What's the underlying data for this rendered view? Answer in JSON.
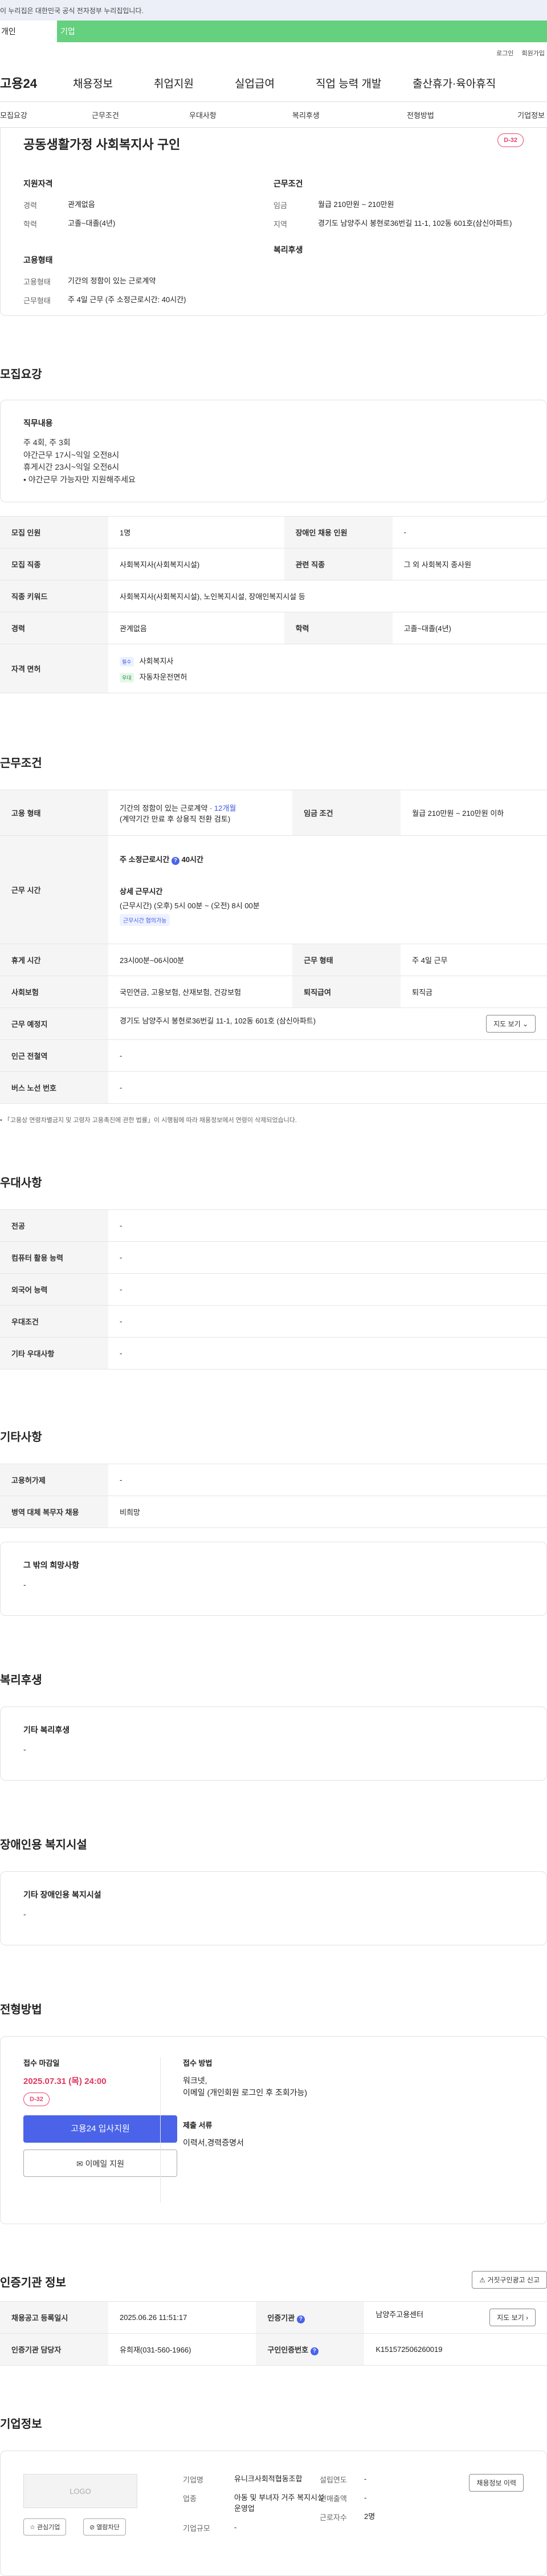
{
  "banner": "이 누리집은 대한민국 공식 전자정부 누리집입니다.",
  "tabs": [
    "개인",
    "기업"
  ],
  "util": [
    "로그인",
    "회원가입"
  ],
  "gnb": {
    "logo": "고용24",
    "items": [
      "채용정보",
      "취업지원",
      "실업급여",
      "직업 능력 개발",
      "출산휴가·육아휴직"
    ]
  },
  "subnav": [
    "모집요강",
    "근무조건",
    "우대사항",
    "복리후생",
    "전형방법",
    "기업정보"
  ],
  "summary": {
    "title": "공동생활가정 사회복지사 구인",
    "dday": "D-32",
    "qual_h": "지원자격",
    "career_k": "경력",
    "career_v": "관계없음",
    "edu_k": "학력",
    "edu_v": "고졸~대졸(4년)",
    "cond_h": "근무조건",
    "wage_k": "임금",
    "wage_v": "월급 210만원 ~ 210만원",
    "loc_k": "지역",
    "loc_v": "경기도 남양주시 봉현로36번길 11-1, 102동 601호(삼신아파트)",
    "emp_h": "고용형태",
    "emptype_k": "고용형태",
    "emptype_v": "기간의 정함이 있는 근로계약",
    "worktype_k": "근무형태",
    "worktype_v": "주 4일 근무 (주 소정근로시간: 40시간)",
    "welfare_h": "복리후생"
  },
  "recruit": {
    "title": "모집요강",
    "duty_h": "직무내용",
    "duty_lines": [
      "주 4회, 주 3회",
      "야간근무 17시~익일 오전8시",
      "휴게시간 23시~익일 오전6시",
      "• 야간근무 가능자만 지원해주세요"
    ],
    "rows": {
      "count_k": "모집 인원",
      "count_v": "1명",
      "disab_k": "장애인 채용 인원",
      "disab_v": "-",
      "job_k": "모집 직종",
      "job_v": "사회복지사(사회복지시설)",
      "rel_k": "관련 직종",
      "rel_v": "그 외 사회복지 종사원",
      "kw_k": "직종 키워드",
      "kw_v": "사회복지사(사회복지시설), 노인복지시설, 장애인복지시설 등",
      "career_k": "경력",
      "career_v": "관계없음",
      "edu_k": "학력",
      "edu_v": "고졸~대졸(4년)",
      "lic_k": "자격 면허",
      "tag1": "필수",
      "lic1": "사회복지사",
      "tag2": "우대",
      "lic2": "자동차운전면허"
    }
  },
  "work": {
    "title": "근무조건",
    "emp_k": "고용 형태",
    "emp_v": "기간의 정함이 있는 근로계약 · ",
    "emp_months": "12개월",
    "emp_sub": "(계약기간 만료 후 상용직 전환 검토)",
    "wage_k": "임금 조건",
    "wage_v": "월급 210만원 ~ 210만원 이하",
    "time_k": "근무 시간",
    "time_std": "주 소정근로시간",
    "time_std_v": "40시간",
    "time_detail_h": "상세 근무시간",
    "time_detail": "(근무시간) (오후) 5시 00분 ~ (오전) 8시 00분",
    "time_pill": "근무시간 협의가능",
    "rest_k": "휴게 시간",
    "rest_v": "23시00분~06시00분",
    "shape_k": "근무 형태",
    "shape_v": "주 4일 근무",
    "ins_k": "사회보험",
    "ins_v": "국민연금, 고용보험, 산재보험, 건강보험",
    "ret_k": "퇴직급여",
    "ret_v": "퇴직금",
    "place_k": "근무 예정지",
    "place_v": "경기도 남양주시 봉현로36번길 11-1, 102동 601호 (삼신아파트)",
    "map_btn": "지도 보기",
    "station_k": "인근 전철역",
    "station_v": "-",
    "bus_k": "버스 노선 번호",
    "bus_v": "-",
    "note": "「고용상 연령차별금지 및 고령자 고용촉진에 관한 법률」이 시행됨에 따라 채용정보에서 연령이 삭제되었습니다."
  },
  "pref": {
    "title": "우대사항",
    "rows": [
      [
        "전공",
        "-"
      ],
      [
        "컴퓨터 활용 능력",
        "-"
      ],
      [
        "외국어 능력",
        "-"
      ],
      [
        "우대조건",
        "-"
      ],
      [
        "기타 우대사항",
        "-"
      ]
    ]
  },
  "etc": {
    "title": "기타사항",
    "rows": [
      [
        "고용허가제",
        "-"
      ],
      [
        "병역 대체 복무자 채용",
        "비희망"
      ]
    ],
    "box_h": "그 밖의 희망사항",
    "box_v": "-"
  },
  "welfare": {
    "title": "복리후생",
    "box_h": "기타 복리후생",
    "box_v": "-"
  },
  "disab": {
    "title": "장애인용 복지시설",
    "box_h": "기타 장애인용 복지시설",
    "box_v": "-"
  },
  "apply": {
    "title": "전형방법",
    "deadline_h": "접수 마감일",
    "deadline": "2025.07.31 (목) 24:00",
    "dday": "D-32",
    "btn1": "고용24 입사지원",
    "btn2": "이메일 지원",
    "method_h": "접수 방법",
    "method": [
      "워크넷,",
      "이메일 (개인회원 로그인 후 조회가능)"
    ],
    "docs_h": "제출 서류",
    "docs": "이력서,경력증명서"
  },
  "cert": {
    "title": "인증기관 정보",
    "report_btn": "거짓구인광고 신고",
    "rows": {
      "reg_k": "채용공고 등록일시",
      "reg_v": "2025.06.26 11:51:17",
      "org_k": "인증기관",
      "org_v": "남양주고용센터",
      "map_btn": "지도 보기",
      "mgr_k": "인증기관 담당자",
      "mgr_v": "유희재(031-560-1966)",
      "no_k": "구인인증번호",
      "no_v": "K151572506260019"
    }
  },
  "company": {
    "title": "기업정보",
    "logo": "LOGO",
    "fav_btn": "관심기업",
    "block_btn": "열람차단",
    "name_k": "기업명",
    "name_v": "유니크사회적협동조합",
    "ind_k": "업종",
    "ind_v": "아동 및 부녀자 거주 복지시설 운영업",
    "size_k": "기업규모",
    "size_v": "-",
    "year_k": "설립연도",
    "year_v": "-",
    "sales_k": "연매출액",
    "sales_v": "-",
    "emp_k": "근로자수",
    "emp_v": "2명",
    "job_btn": "채용정보 이력"
  }
}
